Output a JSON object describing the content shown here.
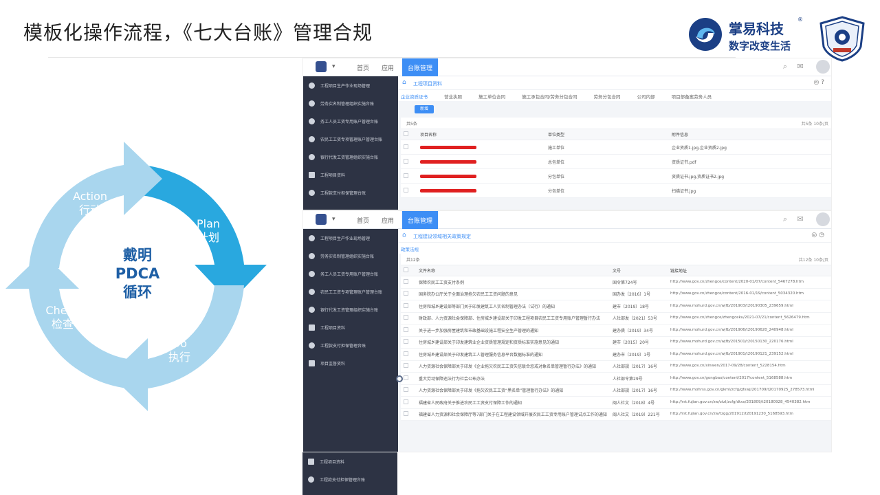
{
  "slide": {
    "title": "模板化操作流程，《七大台账》管理合规"
  },
  "brand": {
    "name": "掌易科技",
    "tagline": "数字改变生活",
    "tm": "®"
  },
  "pdca": {
    "center_line1": "戴明",
    "center_line2": "PDCA",
    "center_line3": "循环",
    "plan_en": "Plan",
    "plan_cn": "计划",
    "do_en": "Do",
    "do_cn": "执行",
    "check_en": "Check",
    "check_cn": "检查",
    "action_en": "Action",
    "action_cn": "行动"
  },
  "app1": {
    "nav": {
      "home": "首页",
      "apps": "应用",
      "active": "台账管理"
    },
    "sidebar": [
      "工程项目生产作业现场管理",
      "劳务实名制管理组织实施台账",
      "务工人员工资专用账户管理台账",
      "农民工工资专项管理账户管理台账",
      "银行代发工资管理组织实施台账",
      "工程项目资料",
      "工程款支付担保管理台账"
    ],
    "breadcrumb": "工程项目资料",
    "tabs": [
      "企业资质证书",
      "营业执照",
      "施工单位合同",
      "施工承包合同/劳务分包合同",
      "劳务分包合同",
      "公司内部",
      "项目部备案劳务人员"
    ],
    "new_button": "新增",
    "count": "共5条",
    "pager": "共5条  10条/页",
    "columns": [
      "项目名称",
      "单位类型",
      "附件信息"
    ],
    "rows": [
      {
        "type": "施工单位",
        "file": "企业资质1.jpg,企业资质2.jpg"
      },
      {
        "type": "总包单位",
        "file": "资质证书.pdf"
      },
      {
        "type": "分包单位",
        "file": "资质证书.jpg,资质证书2.jpg"
      },
      {
        "type": "分包单位",
        "file": "扫描证书.jpg"
      }
    ]
  },
  "app2": {
    "nav": {
      "home": "首页",
      "apps": "应用",
      "active": "台账管理"
    },
    "sidebar": [
      "工程项目生产作业现场管理",
      "劳务实名制管理组织实施台账",
      "务工人员工资专用账户管理台账",
      "农民工工资专项管理账户管理台账",
      "银行代发工资管理组织实施台账",
      "工程项目资料",
      "工程款支付担保管理台账",
      "项目监督资料"
    ],
    "sidebar_bottom": [
      "工程项目资料",
      "工程款支付担保管理台账"
    ],
    "breadcrumb": "工程建设领域相关政策规定",
    "sub_tab": "政策法规",
    "count": "共12条",
    "pager": "共12条  10条/页",
    "columns": [
      "文件名称",
      "文号",
      "链接地址"
    ],
    "rows": [
      {
        "name": "保障农民工工资支付条例",
        "no": "国令第724号",
        "url": "http://www.gov.cn/zhengce/content/2020-01/07/content_5467278.htm"
      },
      {
        "name": "国务院办公厅关于全面治理拖欠农民工工资问题的意见",
        "no": "国办发〔2016〕1号",
        "url": "http://www.gov.cn/zhengce/content/2016-01/19/content_5034320.htm"
      },
      {
        "name": "住房和城乡建设部等部门关于印发建筑工人实名制管理办法（试行）的通知",
        "no": "建市〔2019〕18号",
        "url": "http://www.mohurd.gov.cn/wjfb/201903/t20190305_239659.html"
      },
      {
        "name": "财政部、人力资源社会保障部、住房城乡建设部关于印发工程项目农民工工资专用账户管理暂行办法",
        "no": "人社部发〔2021〕53号",
        "url": "http://www.gov.cn/zhengce/zhengceku/2021-07/21/content_5626479.htm"
      },
      {
        "name": "关于进一步加强房屋建筑和市政基础设施工程安全生产管理的通知",
        "no": "建办质〔2019〕34号",
        "url": "http://www.mohurd.gov.cn/wjfb/201906/t20190620_240948.html"
      },
      {
        "name": "住房城乡建设部关于印发建筑业企业资质管理规定和资质标准实施意见的通知",
        "no": "建市〔2015〕20号",
        "url": "http://www.mohurd.gov.cn/wjfb/201501/t20150130_220176.html"
      },
      {
        "name": "住房城乡建设部关于印发建筑工人管理服务信息平台数据标准的通知",
        "no": "建办市〔2019〕1号",
        "url": "http://www.mohurd.gov.cn/wjfb/201901/t20190121_239152.html"
      },
      {
        "name": "人力资源社会保障部关于印发《企业拖欠农民工工资失信联合惩戒对象名单管理暂行办法》的通知",
        "no": "人社部规〔2017〕16号",
        "url": "http://www.gov.cn/xinwen/2017-09/28/content_5228154.htm"
      },
      {
        "name": "重大劳动保障违法行为社会公布办法",
        "no": "人社部令第29号",
        "url": "http://www.gov.cn/gongbao/content/2017/content_5168588.htm"
      },
      {
        "name": "人力资源社会保障部关于印发《拖欠农民工工资“黑名单”管理暂行办法》的通知",
        "no": "人社部规〔2017〕16号",
        "url": "http://www.mohrss.gov.cn/gkml/zcfg/gfxwj/201709/t20170925_278573.html"
      },
      {
        "name": "福建省人民政府关于推进农民工工资支付保障工作的通知",
        "no": "闽人社文〔2018〕4号",
        "url": "http://rst.fujian.gov.cn/zw/ztzl/zcfg/dtxx/201809/t20180928_4540382.htm"
      },
      {
        "name": "福建省人力资源和社会保障厅等7部门关于在工程建设领域开展农民工工资专用账户管理试点工作的通知",
        "no": "闽人社文〔2019〕221号",
        "url": "http://rst.fujian.gov.cn/zw/tzgg/201912/t20191230_5168593.htm"
      }
    ]
  },
  "colors": {
    "accent": "#3d8ef5",
    "sidebar": "#2d3344",
    "pdca_dark": "#29a8df",
    "pdca_light": "#a9d6ee",
    "brand": "#1b3f85",
    "redaction": "#e02020"
  }
}
